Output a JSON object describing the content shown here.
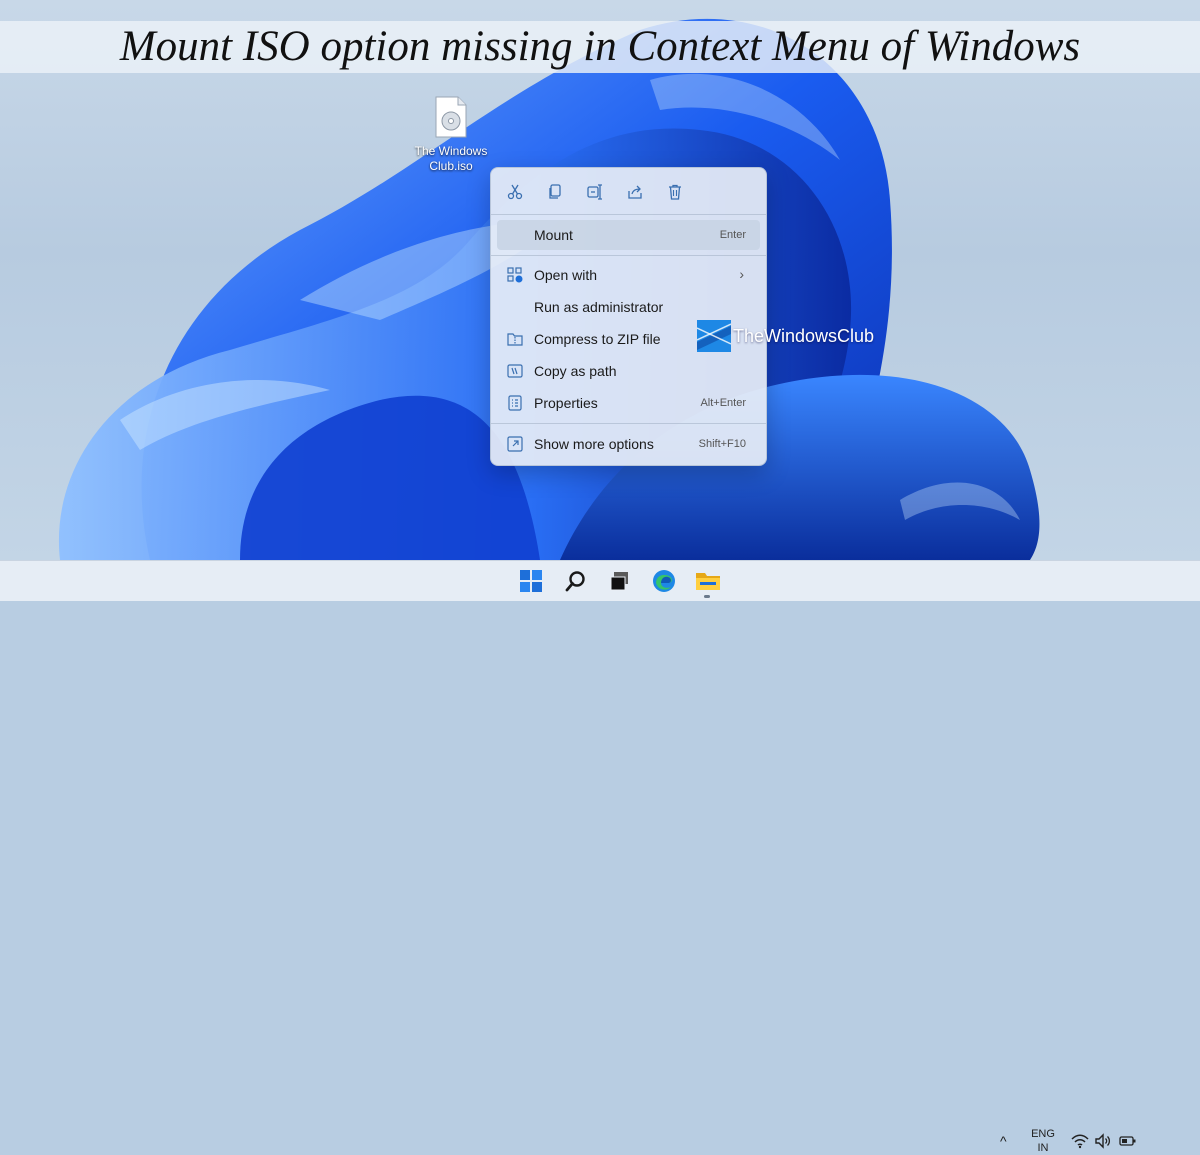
{
  "title": "Mount ISO option missing in Context Menu of Windows",
  "desktop_icon": {
    "label": "The Windows Club.iso",
    "icon": "iso-file-icon"
  },
  "context_menu": {
    "quick_actions": [
      {
        "icon": "cut-icon",
        "label": "Cut"
      },
      {
        "icon": "copy-icon",
        "label": "Copy"
      },
      {
        "icon": "rename-icon",
        "label": "Rename"
      },
      {
        "icon": "share-icon",
        "label": "Share"
      },
      {
        "icon": "delete-icon",
        "label": "Delete"
      }
    ],
    "items": [
      {
        "label": "Mount",
        "shortcut": "Enter",
        "icon": "",
        "highlighted": true
      },
      {
        "label": "Open with",
        "shortcut": "",
        "icon": "open-with-icon",
        "submenu": true
      },
      {
        "label": "Run as administrator",
        "shortcut": "",
        "icon": ""
      },
      {
        "label": "Compress to ZIP file",
        "shortcut": "",
        "icon": "zip-folder-icon"
      },
      {
        "label": "Copy as path",
        "shortcut": "",
        "icon": "copy-path-icon"
      },
      {
        "label": "Properties",
        "shortcut": "Alt+Enter",
        "icon": "properties-icon"
      },
      {
        "label": "Show more options",
        "shortcut": "Shift+F10",
        "icon": "more-options-icon"
      }
    ]
  },
  "watermark": {
    "text": "TheWindowsClub"
  },
  "taskbar": {
    "apps": [
      {
        "icon": "start-icon",
        "label": "Start"
      },
      {
        "icon": "search-icon",
        "label": "Search"
      },
      {
        "icon": "task-view-icon",
        "label": "Task View"
      },
      {
        "icon": "edge-icon",
        "label": "Microsoft Edge"
      },
      {
        "icon": "file-explorer-icon",
        "label": "File Explorer"
      }
    ],
    "tray": {
      "chevron": "^",
      "lang_line1": "ENG",
      "lang_line2": "IN",
      "icons": [
        "wifi-icon",
        "volume-icon",
        "battery-icon"
      ]
    }
  },
  "colors": {
    "wallpaper_blue": "#1a5cf0",
    "accent": "#1e6fd9"
  }
}
